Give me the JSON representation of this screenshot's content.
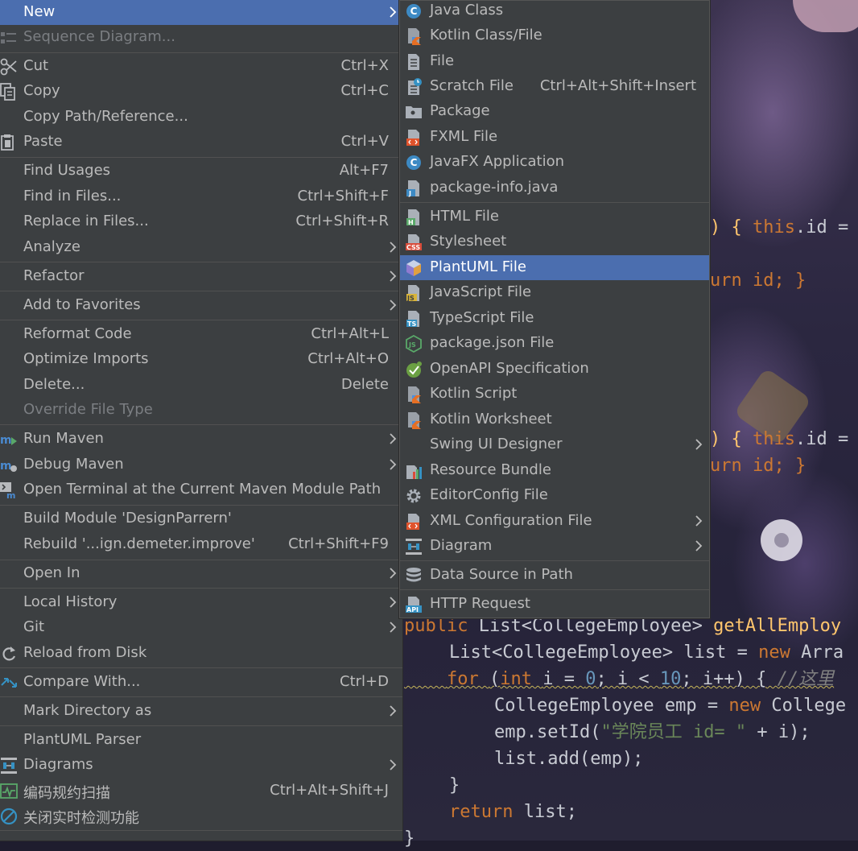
{
  "colors": {
    "menu_bg": "#3c3f41",
    "selection": "#4b6eaf",
    "text": "#bbbbbb",
    "disabled_text": "#7b7e82",
    "keyword": "#cc7832",
    "method": "#ffc66d",
    "number": "#6897bb",
    "string": "#6a8759"
  },
  "main_menu": {
    "items": [
      {
        "label": "New",
        "selected": true,
        "submenu": true
      },
      {
        "label": "Sequence Diagram...",
        "disabled": true,
        "icon": "sequence-diagram-icon"
      },
      {
        "label": "Cut",
        "shortcut": "Ctrl+X",
        "icon": "scissors-icon"
      },
      {
        "label": "Copy",
        "shortcut": "Ctrl+C",
        "icon": "copy-icon"
      },
      {
        "label": "Copy Path/Reference..."
      },
      {
        "label": "Paste",
        "shortcut": "Ctrl+V",
        "icon": "clipboard-icon"
      },
      {
        "label": "Find Usages",
        "shortcut": "Alt+F7"
      },
      {
        "label": "Find in Files...",
        "shortcut": "Ctrl+Shift+F"
      },
      {
        "label": "Replace in Files...",
        "shortcut": "Ctrl+Shift+R"
      },
      {
        "label": "Analyze",
        "submenu": true
      },
      {
        "label": "Refactor",
        "submenu": true
      },
      {
        "label": "Add to Favorites",
        "submenu": true
      },
      {
        "label": "Reformat Code",
        "shortcut": "Ctrl+Alt+L"
      },
      {
        "label": "Optimize Imports",
        "shortcut": "Ctrl+Alt+O"
      },
      {
        "label": "Delete...",
        "shortcut": "Delete"
      },
      {
        "label": "Override File Type",
        "disabled": true
      },
      {
        "label": "Run Maven",
        "submenu": true,
        "icon": "maven-run-icon"
      },
      {
        "label": "Debug Maven",
        "submenu": true,
        "icon": "maven-debug-icon"
      },
      {
        "label": "Open Terminal at the Current Maven Module Path",
        "icon": "maven-terminal-icon"
      },
      {
        "label": "Build Module 'DesignParrern'"
      },
      {
        "label": "Rebuild '...ign.demeter.improve'",
        "shortcut": "Ctrl+Shift+F9"
      },
      {
        "label": "Open In",
        "submenu": true
      },
      {
        "label": "Local History",
        "submenu": true
      },
      {
        "label": "Git",
        "submenu": true
      },
      {
        "label": "Reload from Disk",
        "icon": "reload-icon"
      },
      {
        "label": "Compare With...",
        "shortcut": "Ctrl+D",
        "icon": "compare-icon"
      },
      {
        "label": "Mark Directory as",
        "submenu": true
      },
      {
        "label": "PlantUML Parser"
      },
      {
        "label": "Diagrams",
        "submenu": true,
        "icon": "diagram-icon"
      },
      {
        "label": "编码规约扫描",
        "shortcut": "Ctrl+Alt+Shift+J",
        "icon": "scan-icon"
      },
      {
        "label": "关闭实时检测功能",
        "icon": "disable-icon"
      }
    ]
  },
  "new_submenu": {
    "items": [
      {
        "label": "Java Class",
        "icon": "java-class-icon"
      },
      {
        "label": "Kotlin Class/File",
        "icon": "kotlin-file-icon"
      },
      {
        "label": "File",
        "icon": "file-icon"
      },
      {
        "label": "Scratch File",
        "shortcut": "Ctrl+Alt+Shift+Insert",
        "icon": "scratch-file-icon"
      },
      {
        "label": "Package",
        "icon": "package-icon"
      },
      {
        "label": "FXML File",
        "icon": "fxml-file-icon"
      },
      {
        "label": "JavaFX Application",
        "icon": "javafx-icon"
      },
      {
        "label": "package-info.java",
        "icon": "package-info-icon"
      },
      {
        "label": "HTML File",
        "icon": "html-file-icon"
      },
      {
        "label": "Stylesheet",
        "icon": "css-file-icon"
      },
      {
        "label": "PlantUML File",
        "selected": true,
        "icon": "plantuml-file-icon"
      },
      {
        "label": "JavaScript File",
        "icon": "js-file-icon"
      },
      {
        "label": "TypeScript File",
        "icon": "ts-file-icon"
      },
      {
        "label": "package.json File",
        "icon": "nodejs-icon"
      },
      {
        "label": "OpenAPI Specification",
        "icon": "openapi-icon"
      },
      {
        "label": "Kotlin Script",
        "icon": "kotlin-script-icon"
      },
      {
        "label": "Kotlin Worksheet",
        "icon": "kotlin-worksheet-icon"
      },
      {
        "label": "Swing UI Designer",
        "submenu": true
      },
      {
        "label": "Resource Bundle",
        "icon": "resource-bundle-icon"
      },
      {
        "label": "EditorConfig File",
        "icon": "gear-icon"
      },
      {
        "label": "XML Configuration File",
        "submenu": true,
        "icon": "xml-file-icon"
      },
      {
        "label": "Diagram",
        "submenu": true,
        "icon": "diagram-icon"
      },
      {
        "label": "Data Source in Path",
        "icon": "database-icon"
      },
      {
        "label": "HTTP Request",
        "icon": "http-request-icon"
      }
    ]
  },
  "editor": {
    "fragments": {
      "f1": ") { ",
      "f1b": "this",
      "f1c": ".id =",
      "f2": "urn id; }",
      "f3": ") { ",
      "f3b": "this",
      "f3c": ".id =",
      "f4": "urn id; }"
    },
    "lines": {
      "l1_kw": "public ",
      "l1_type": "List<CollegeEmployee> ",
      "l1_fn": "getAllEmploy",
      "l2_a": "List<CollegeEmployee> list = ",
      "l2_kw": "new ",
      "l2_b": "Arra",
      "l3_kw": "for ",
      "l3_a": "(",
      "l3_int": "int ",
      "l3_b": "i = ",
      "l3_n1": "0",
      "l3_c": "; i < ",
      "l3_n2": "10",
      "l3_d": "; i++) { ",
      "l3_cmt": "//这里",
      "l4_a": "CollegeEmployee emp = ",
      "l4_kw": "new ",
      "l4_b": "College",
      "l5_a": "emp.setId(",
      "l5_str": "\"学院员工 id= \"",
      "l5_b": " + i);",
      "l6": "list.add(emp);",
      "l7": "}",
      "l8_kw": "return ",
      "l8_a": "list;",
      "l9": "}"
    }
  }
}
